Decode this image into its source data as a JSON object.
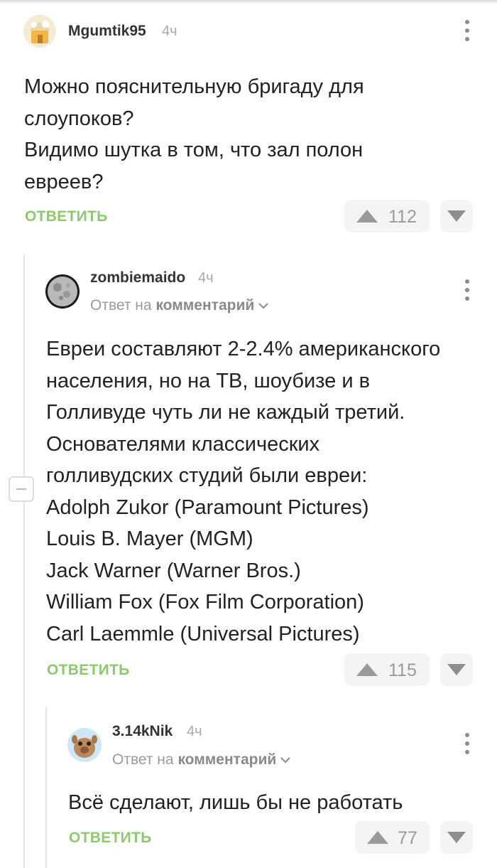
{
  "colors": {
    "accent_green": "#8dc96f",
    "muted_gray": "#a8a8a8",
    "vote_bg": "#f4f4f4"
  },
  "comments": [
    {
      "author": "Mgumtik95",
      "time": "4ч",
      "avatar_icon": "cartoon-house-avatar",
      "lines": [
        "Можно пояснительную бригаду для",
        "слоупоков?",
        "Видимо шутка в том, что зал полон",
        "евреев?"
      ],
      "reply_label": "ОТВЕТИТЬ",
      "rating": "112"
    },
    {
      "author": "zombiemaido",
      "time": "4ч",
      "avatar_icon": "moon-avatar",
      "reply_prefix": "Ответ на",
      "reply_target": "комментарий",
      "lines": [
        "Евреи составляют 2-2.4% американского",
        "населения, но на ТВ, шоубизе и в",
        "Голливуде чуть ли не каждый третий.",
        "Основателями классических",
        "голливудских студий были евреи:",
        "Adolph Zukor (Paramount Pictures)",
        "Louis B. Mayer (MGM)",
        "Jack Warner (Warner Bros.)",
        "William Fox (Fox Film Corporation)",
        "Carl Laemmle (Universal Pictures)"
      ],
      "reply_label": "ОТВЕТИТЬ",
      "rating": "115"
    },
    {
      "author": "3.14kNik",
      "time": "4ч",
      "avatar_icon": "alf-avatar",
      "reply_prefix": "Ответ на",
      "reply_target": "комментарий",
      "lines": [
        "Всё сделают, лишь бы не работать"
      ],
      "reply_label": "ОТВЕТИТЬ",
      "rating": "77"
    }
  ]
}
